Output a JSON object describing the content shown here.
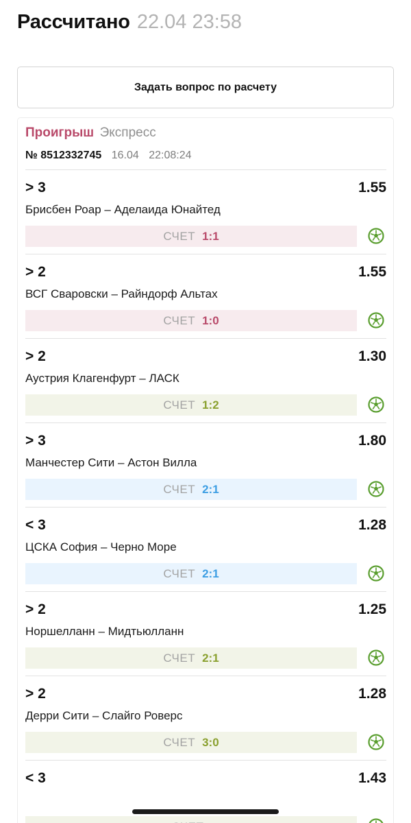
{
  "header": {
    "title": "Рассчитано",
    "datetime": "22.04 23:58"
  },
  "ask_button": "Задать вопрос по расчету",
  "bet": {
    "status": "Проигрыш",
    "type": "Экспресс",
    "number": "№ 8512332745",
    "date": "16.04",
    "time": "22:08:24",
    "score_label": "СЧЕТ",
    "events": [
      {
        "selection": "> 3",
        "odds": "1.55",
        "match": "Брисбен Роар – Аделаида Юнайтед",
        "score": "1:1",
        "tone": "pink"
      },
      {
        "selection": "> 2",
        "odds": "1.55",
        "match": "ВСГ Сваровски – Райндорф Альтах",
        "score": "1:0",
        "tone": "pink"
      },
      {
        "selection": "> 2",
        "odds": "1.30",
        "match": "Аустрия Клагенфурт – ЛАСК",
        "score": "1:2",
        "tone": "olive"
      },
      {
        "selection": "> 3",
        "odds": "1.80",
        "match": "Манчестер Сити – Астон Вилла",
        "score": "2:1",
        "tone": "blue"
      },
      {
        "selection": "< 3",
        "odds": "1.28",
        "match": "ЦСКА София – Черно Море",
        "score": "2:1",
        "tone": "blue"
      },
      {
        "selection": "> 2",
        "odds": "1.25",
        "match": "Норшелланн – Мидтьюлланн",
        "score": "2:1",
        "tone": "olive"
      },
      {
        "selection": "> 2",
        "odds": "1.28",
        "match": "Дерри Сити – Слайго Роверс",
        "score": "3:0",
        "tone": "olive"
      },
      {
        "selection": "< 3",
        "odds": "1.43",
        "match": "",
        "score": "",
        "tone": "olive"
      }
    ]
  },
  "icons": {
    "sport": "soccer-ball-icon"
  },
  "colors": {
    "loss": "#b94a6a",
    "win_olive": "#8aa02f",
    "blue": "#3d9ee3",
    "ball_green": "#5a9e2f"
  }
}
